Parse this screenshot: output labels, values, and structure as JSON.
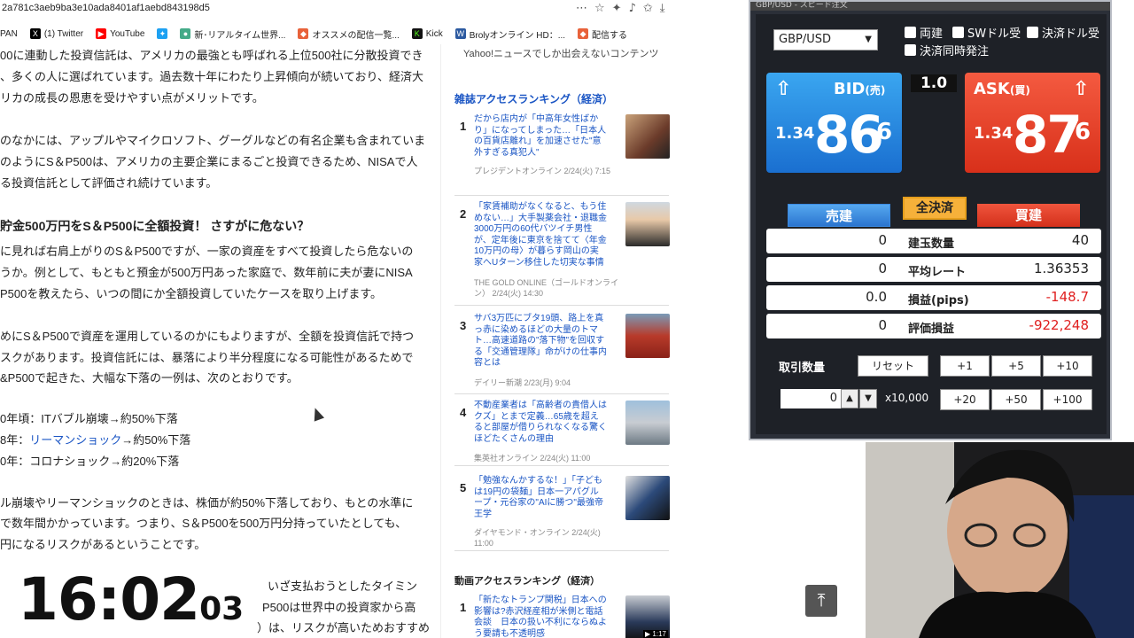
{
  "browser": {
    "url": "2a781c3aeb9ba3e10ada8401af1aebd843198d5",
    "bookmarks": [
      "PAN",
      "(1) Twitter",
      "YouTube",
      "新･リアルタイム世界...",
      "オススメの配信一覧...",
      "Kick",
      "Brolyオンライン HD：...",
      "配信する"
    ]
  },
  "article": {
    "lines": [
      "00に連動した投資信託は、アメリカの最強とも呼ばれる上位500社に分散投資でき",
      "、多くの人に選ばれています。過去数十年にわたり上昇傾向が続いており、経済大",
      "リカの成長の恩恵を受けやすい点がメリットです。",
      "のなかには、アップルやマイクロソフト、グーグルなどの有名企業も含まれていま",
      "のようにS＆P500は、アメリカの主要企業にまるごと投資できるため、NISAで人",
      "る投資信託として評価され続けています。"
    ],
    "heading": "貯金500万円をS＆P500に全額投資！ さすがに危ない？",
    "lines2": [
      "に見れば右肩上がりのS＆P500ですが、一家の資産をすべて投資したら危ないの",
      "うか。例として、もともと預金が500万円あった家庭で、数年前に夫が妻にNISA",
      "P500を教えたら、いつの間にか全額投資していたケースを取り上げます。",
      "めにS＆P500で資産を運用しているのかにもよりますが、全額を投資信託で持つ",
      "スクがあります。投資信託には、暴落により半分程度になる可能性があるためで",
      "&P500で起きた、大幅な下落の一例は、次のとおりです。"
    ],
    "crash1": "0年頃：ITバブル崩壊→約50%下落",
    "crash2_prefix": "8年：",
    "crash2_link": "リーマンショック",
    "crash2_suffix": "→約50%下落",
    "crash3": "0年：コロナショック→約20%下落",
    "lines3": [
      "ル崩壊やリーマンショックのときは、株価が約50%下落しており、もとの水準に",
      "で数年間かかっています。つまり、S＆P500を500万円分持っていたとしても、",
      "円になるリスクがあるということです。"
    ],
    "tail": [
      "いざ支払おうとしたタイミン",
      "P500は世界中の投資家から高",
      "）は、リスクが高いためおすすめ"
    ]
  },
  "clock": {
    "hm": "16:02",
    "sec": "03"
  },
  "sidebar": {
    "top_text": "Yahoo!ニュースでしか出会えないコンテンツ",
    "heading": "雑誌アクセスランキング（経済）",
    "items": [
      {
        "n": "1",
        "title": "だから店内が「中高年女性ばかり」になってしまった…「日本人の百貨店離れ」を加速させた\"意外すぎる真犯人\"",
        "meta": "プレジデントオンライン 2/24(火) 7:15"
      },
      {
        "n": "2",
        "title": "「家賃補助がなくなると、もう住めない…」大手製薬会社・退職金3000万円の60代バツイチ男性が、定年後に東京を捨てて〈年金10万円の母〉が暮らす岡山の実家へUターン移住した切実な事情",
        "meta": "THE GOLD ONLINE（ゴールドオンライン） 2/24(火) 14:30"
      },
      {
        "n": "3",
        "title": "サバ3万匹にブタ19頭、路上を真っ赤に染めるほどの大量のトマト…高速道路の\"落下物\"を回収する「交通管理隊」命がけの仕事内容とは",
        "meta": "デイリー新潮 2/23(月) 9:04"
      },
      {
        "n": "4",
        "title": "不動産業者は「高齢者の貴借人はクズ」とまで定義…65歳を超えると部屋が借りられなくなる驚くほどたくさんの理由",
        "meta": "集英社オンライン 2/24(火) 11:00"
      },
      {
        "n": "5",
        "title": "「勉強なんかするな！」「子どもは19円の袋麺」日本一アパグループ・元谷家の\"AIに勝つ\"最強帝王学",
        "meta": "ダイヤモンド・オンライン 2/24(火) 11:00"
      }
    ],
    "video_heading": "動画アクセスランキング（経済）",
    "video_item": {
      "n": "1",
      "title": "「新たなトランプ関税」日本への影響は?赤沢経産相が米側と電話会談　日本の扱い不利にならぬよう要請も不透明感",
      "duration": "▶ 1:17"
    }
  },
  "fx": {
    "title": "GBP/USD - スピード注文",
    "pair": "GBP/USD",
    "options": [
      "両建",
      "SWドル受",
      "決済ドル受",
      "決済同時発注"
    ],
    "bid": {
      "label": "BID",
      "sub": "(売)",
      "prefix": "1.34",
      "big": "86",
      "pip": "6"
    },
    "ask": {
      "label": "ASK",
      "sub": "(買)",
      "prefix": "1.34",
      "big": "87",
      "pip": "6"
    },
    "spread": "1.0",
    "sell": "売建",
    "flatten": "全決済",
    "buy": "買建",
    "rows": [
      {
        "left": "0",
        "label": "建玉数量",
        "right": "40",
        "neg": false
      },
      {
        "left": "0",
        "label": "平均レート",
        "right": "1.36353",
        "neg": false
      },
      {
        "left": "0.0",
        "label": "損益(pips)",
        "right": "-148.7",
        "neg": true
      },
      {
        "left": "0",
        "label": "評価損益",
        "right": "-922,248",
        "neg": true
      }
    ],
    "lot_label": "取引数量",
    "reset": "リセット",
    "lot_value": "0",
    "multiplier": "x10,000",
    "btns1": [
      "+1",
      "+5",
      "+10"
    ],
    "btns2": [
      "+20",
      "+50",
      "+100"
    ],
    "colors": {
      "bid": "#1a6fd0",
      "ask": "#d8301a",
      "flat": "#f6b13a"
    }
  }
}
